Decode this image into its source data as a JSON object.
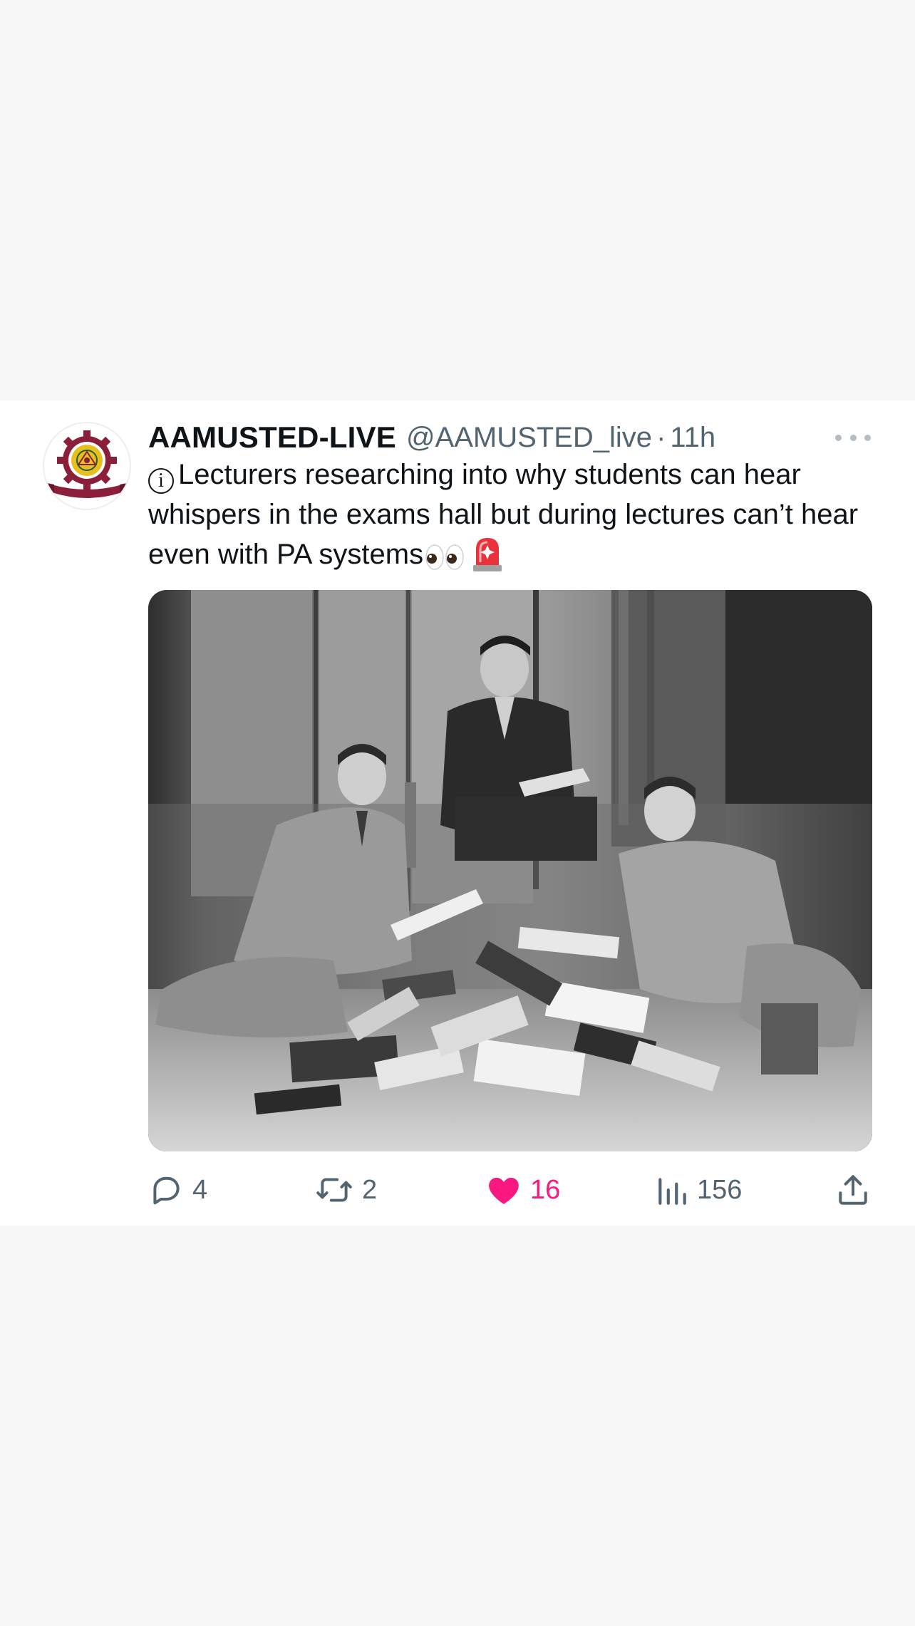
{
  "tweet": {
    "display_name": "AAMUSTED-LIVE",
    "handle": "@AAMUSTED_live",
    "separator": "·",
    "time": "11h",
    "info_symbol": "i",
    "text": "Lecturers researching into why students can hear whispers in the exams hall but during lectures can’t hear even with PA systems",
    "emojis": [
      "eyes-emoji",
      "police-car-light-emoji"
    ],
    "media": {
      "icon": "photo-three-men-reading-books"
    }
  },
  "actions": {
    "replies": {
      "icon": "reply-icon",
      "count": "4"
    },
    "retweets": {
      "icon": "retweet-icon",
      "count": "2"
    },
    "likes": {
      "icon": "heart-filled-icon",
      "count": "16",
      "liked": true
    },
    "views": {
      "icon": "views-chart-icon",
      "count": "156"
    },
    "share": {
      "icon": "share-icon"
    }
  },
  "colors": {
    "page_background": "#f7f7f8",
    "card_background": "#ffffff",
    "text_primary": "#0f1419",
    "text_secondary": "#536471",
    "like_pink": "#f91880",
    "logo_maroon": "#8b1f3a",
    "logo_gold": "#e6c020"
  }
}
